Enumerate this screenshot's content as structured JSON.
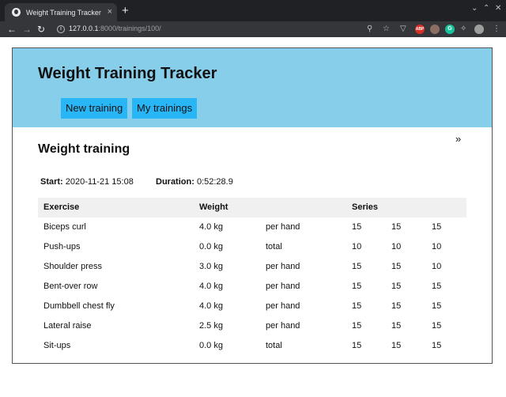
{
  "browser": {
    "tab_title": "Weight Training Tracker",
    "tab_close": "×",
    "new_tab": "+",
    "url_host": "127.0.0.1",
    "url_rest": ":8000/trainings/100/",
    "icons": [
      "back-icon",
      "forward-icon",
      "reload-icon",
      "info-icon",
      "zoom-icon",
      "star-icon",
      "pocket-icon",
      "adblock-icon",
      "extension-icon",
      "grammarly-icon",
      "puzzle-icon",
      "profile-icon",
      "menu-icon"
    ],
    "adblock_label": "ABP",
    "grammarly_label": "G"
  },
  "header": {
    "title": "Weight Training Tracker",
    "nav": [
      {
        "label": "New training"
      },
      {
        "label": "My trainings"
      }
    ]
  },
  "content": {
    "title": "Weight training",
    "next_link": "»",
    "start_label": "Start:",
    "start_value": "2020-11-21 15:08",
    "duration_label": "Duration:",
    "duration_value": "0:52:28.9"
  },
  "table": {
    "headers": {
      "exercise": "Exercise",
      "weight": "Weight",
      "series": "Series"
    },
    "rows": [
      {
        "exercise": "Biceps curl",
        "weight": "4.0 kg",
        "unit": "per hand",
        "s": [
          "15",
          "15",
          "15"
        ]
      },
      {
        "exercise": "Push-ups",
        "weight": "0.0 kg",
        "unit": "total",
        "s": [
          "10",
          "10",
          "10"
        ]
      },
      {
        "exercise": "Shoulder press",
        "weight": "3.0 kg",
        "unit": "per hand",
        "s": [
          "15",
          "15",
          "10"
        ]
      },
      {
        "exercise": "Bent-over row",
        "weight": "4.0 kg",
        "unit": "per hand",
        "s": [
          "15",
          "15",
          "15"
        ]
      },
      {
        "exercise": "Dumbbell chest fly",
        "weight": "4.0 kg",
        "unit": "per hand",
        "s": [
          "15",
          "15",
          "15"
        ]
      },
      {
        "exercise": "Lateral raise",
        "weight": "2.5 kg",
        "unit": "per hand",
        "s": [
          "15",
          "15",
          "15"
        ]
      },
      {
        "exercise": "Sit-ups",
        "weight": "0.0 kg",
        "unit": "total",
        "s": [
          "15",
          "15",
          "15"
        ]
      }
    ]
  }
}
